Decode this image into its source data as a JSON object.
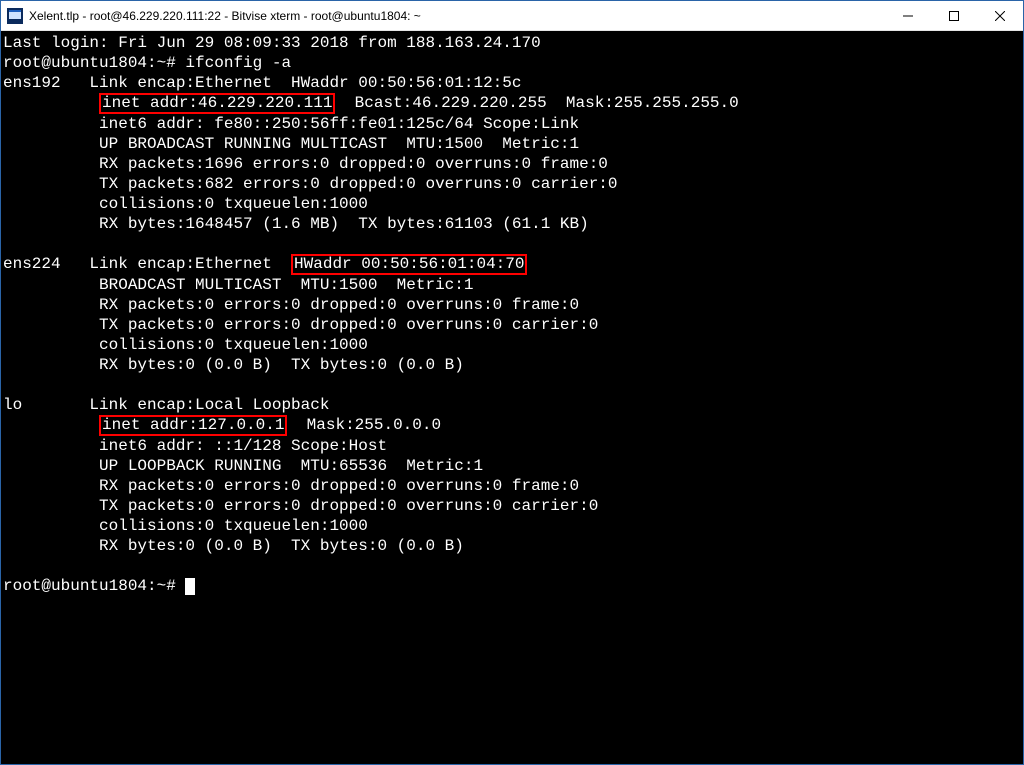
{
  "window": {
    "title": "Xelent.tlp - root@46.229.220.111:22 - Bitvise xterm - root@ubuntu1804: ~"
  },
  "terminal": {
    "lastLogin": "Last login: Fri Jun 29 08:09:33 2018 from 188.163.24.170",
    "promptWithCmd": "root@ubuntu1804:~# ifconfig -a",
    "ens192": {
      "name": "ens192",
      "line1_before": "   Link encap:Ethernet  HWaddr 00:50:56:01:12:5c",
      "inet_hl": "inet addr:46.229.220.111",
      "line2_after": "  Bcast:46.229.220.255  Mask:255.255.255.0",
      "line3": "          inet6 addr: fe80::250:56ff:fe01:125c/64 Scope:Link",
      "line4": "          UP BROADCAST RUNNING MULTICAST  MTU:1500  Metric:1",
      "line5": "          RX packets:1696 errors:0 dropped:0 overruns:0 frame:0",
      "line6": "          TX packets:682 errors:0 dropped:0 overruns:0 carrier:0",
      "line7": "          collisions:0 txqueuelen:1000",
      "line8": "          RX bytes:1648457 (1.6 MB)  TX bytes:61103 (61.1 KB)"
    },
    "ens224": {
      "name": "ens224",
      "line1_before": "   Link encap:Ethernet  ",
      "hwaddr_hl": "HWaddr 00:50:56:01:04:70",
      "line2": "          BROADCAST MULTICAST  MTU:1500  Metric:1",
      "line3": "          RX packets:0 errors:0 dropped:0 overruns:0 frame:0",
      "line4": "          TX packets:0 errors:0 dropped:0 overruns:0 carrier:0",
      "line5": "          collisions:0 txqueuelen:1000",
      "line6": "          RX bytes:0 (0.0 B)  TX bytes:0 (0.0 B)"
    },
    "lo": {
      "name": "lo",
      "line1": "       Link encap:Local Loopback",
      "inet_hl": "inet addr:127.0.0.1",
      "line2_after": "  Mask:255.0.0.0",
      "line3": "          inet6 addr: ::1/128 Scope:Host",
      "line4": "          UP LOOPBACK RUNNING  MTU:65536  Metric:1",
      "line5": "          RX packets:0 errors:0 dropped:0 overruns:0 frame:0",
      "line6": "          TX packets:0 errors:0 dropped:0 overruns:0 carrier:0",
      "line7": "          collisions:0 txqueuelen:1000",
      "line8": "          RX bytes:0 (0.0 B)  TX bytes:0 (0.0 B)"
    },
    "promptEnd": "root@ubuntu1804:~# ",
    "indent10": "          "
  }
}
